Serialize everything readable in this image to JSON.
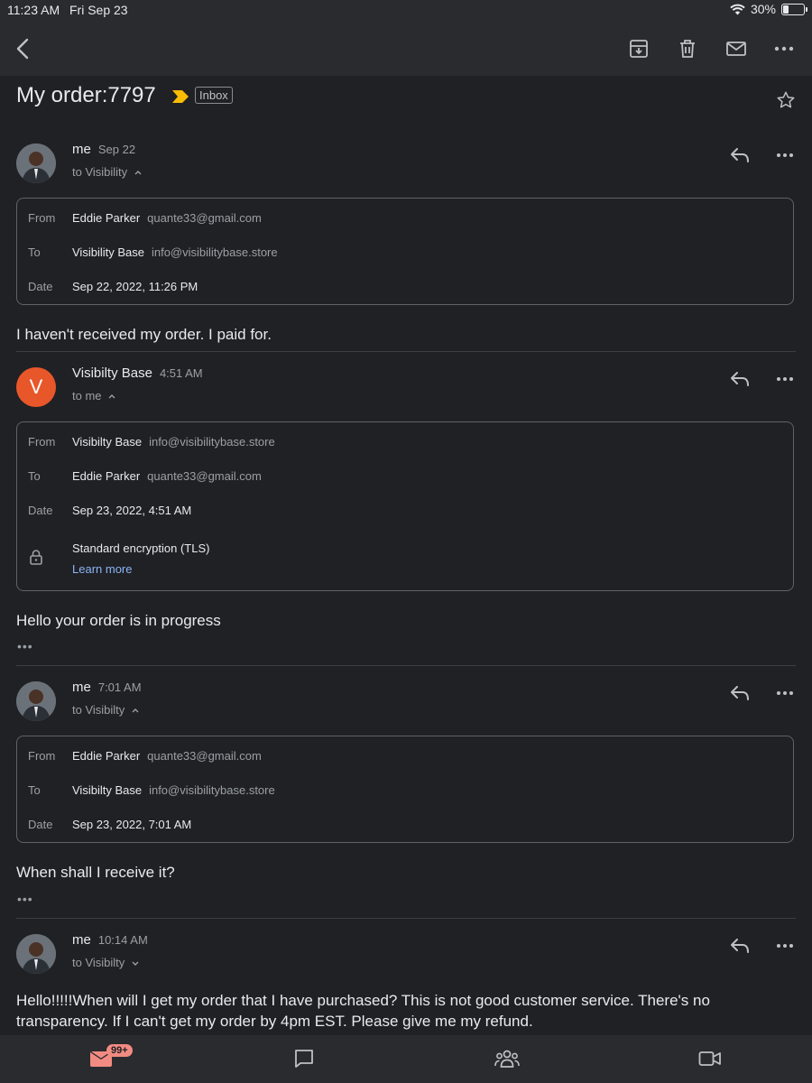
{
  "status": {
    "time": "11:23 AM",
    "date": "Fri Sep 23",
    "battery": "30%",
    "battery_level": 0.3
  },
  "toolbar": {
    "icons": [
      "back-icon",
      "archive-icon",
      "trash-icon",
      "mark-unread-icon",
      "more-icon"
    ]
  },
  "subject": {
    "title": "My order:7797",
    "label": "Inbox"
  },
  "messages": [
    {
      "sender": "me",
      "time": "Sep 22",
      "recipients": "to Visibility",
      "details": {
        "from_label": "From",
        "from_name": "Eddie Parker",
        "from_email": "quante33@gmail.com",
        "to_label": "To",
        "to_name": "Visibility Base",
        "to_email": "info@visibilitybase.store",
        "date_label": "Date",
        "date": "Sep 22, 2022, 11:26 PM"
      },
      "body": "I haven't received my order. I paid for."
    },
    {
      "sender": "Visibilty Base",
      "avatar_letter": "V",
      "time": "4:51 AM",
      "recipients": "to me",
      "details": {
        "from_label": "From",
        "from_name": "Visibilty Base",
        "from_email": "info@visibilitybase.store",
        "to_label": "To",
        "to_name": "Eddie Parker",
        "to_email": "quante33@gmail.com",
        "date_label": "Date",
        "date": "Sep 23, 2022, 4:51 AM",
        "encryption": "Standard encryption (TLS)",
        "learn_more": "Learn more"
      },
      "body": "Hello your order is in progress",
      "more": "•••"
    },
    {
      "sender": "me",
      "time": "7:01 AM",
      "recipients": "to Visibilty",
      "details": {
        "from_label": "From",
        "from_name": "Eddie Parker",
        "from_email": "quante33@gmail.com",
        "to_label": "To",
        "to_name": "Visibilty Base",
        "to_email": "info@visibilitybase.store",
        "date_label": "Date",
        "date": "Sep 23, 2022, 7:01 AM"
      },
      "body": "When shall I receive it?",
      "more": "•••"
    },
    {
      "sender": "me",
      "time": "10:14 AM",
      "recipients": "to Visibilty",
      "body": "Hello!!!!!When will I get my order that I have purchased? This is not good customer service. There's no transparency. If I can't get my order by 4pm EST. Please give me my refund."
    }
  ],
  "bottom_nav": {
    "mail_badge": "99+",
    "icons": [
      "mail-icon",
      "chat-icon",
      "spaces-icon",
      "meet-icon"
    ]
  },
  "colors": {
    "background": "#202124",
    "accent_link": "#8ab4f8",
    "avatar_v": "#e8572a",
    "importance": "#fbbc04",
    "badge": "#f28b82"
  }
}
